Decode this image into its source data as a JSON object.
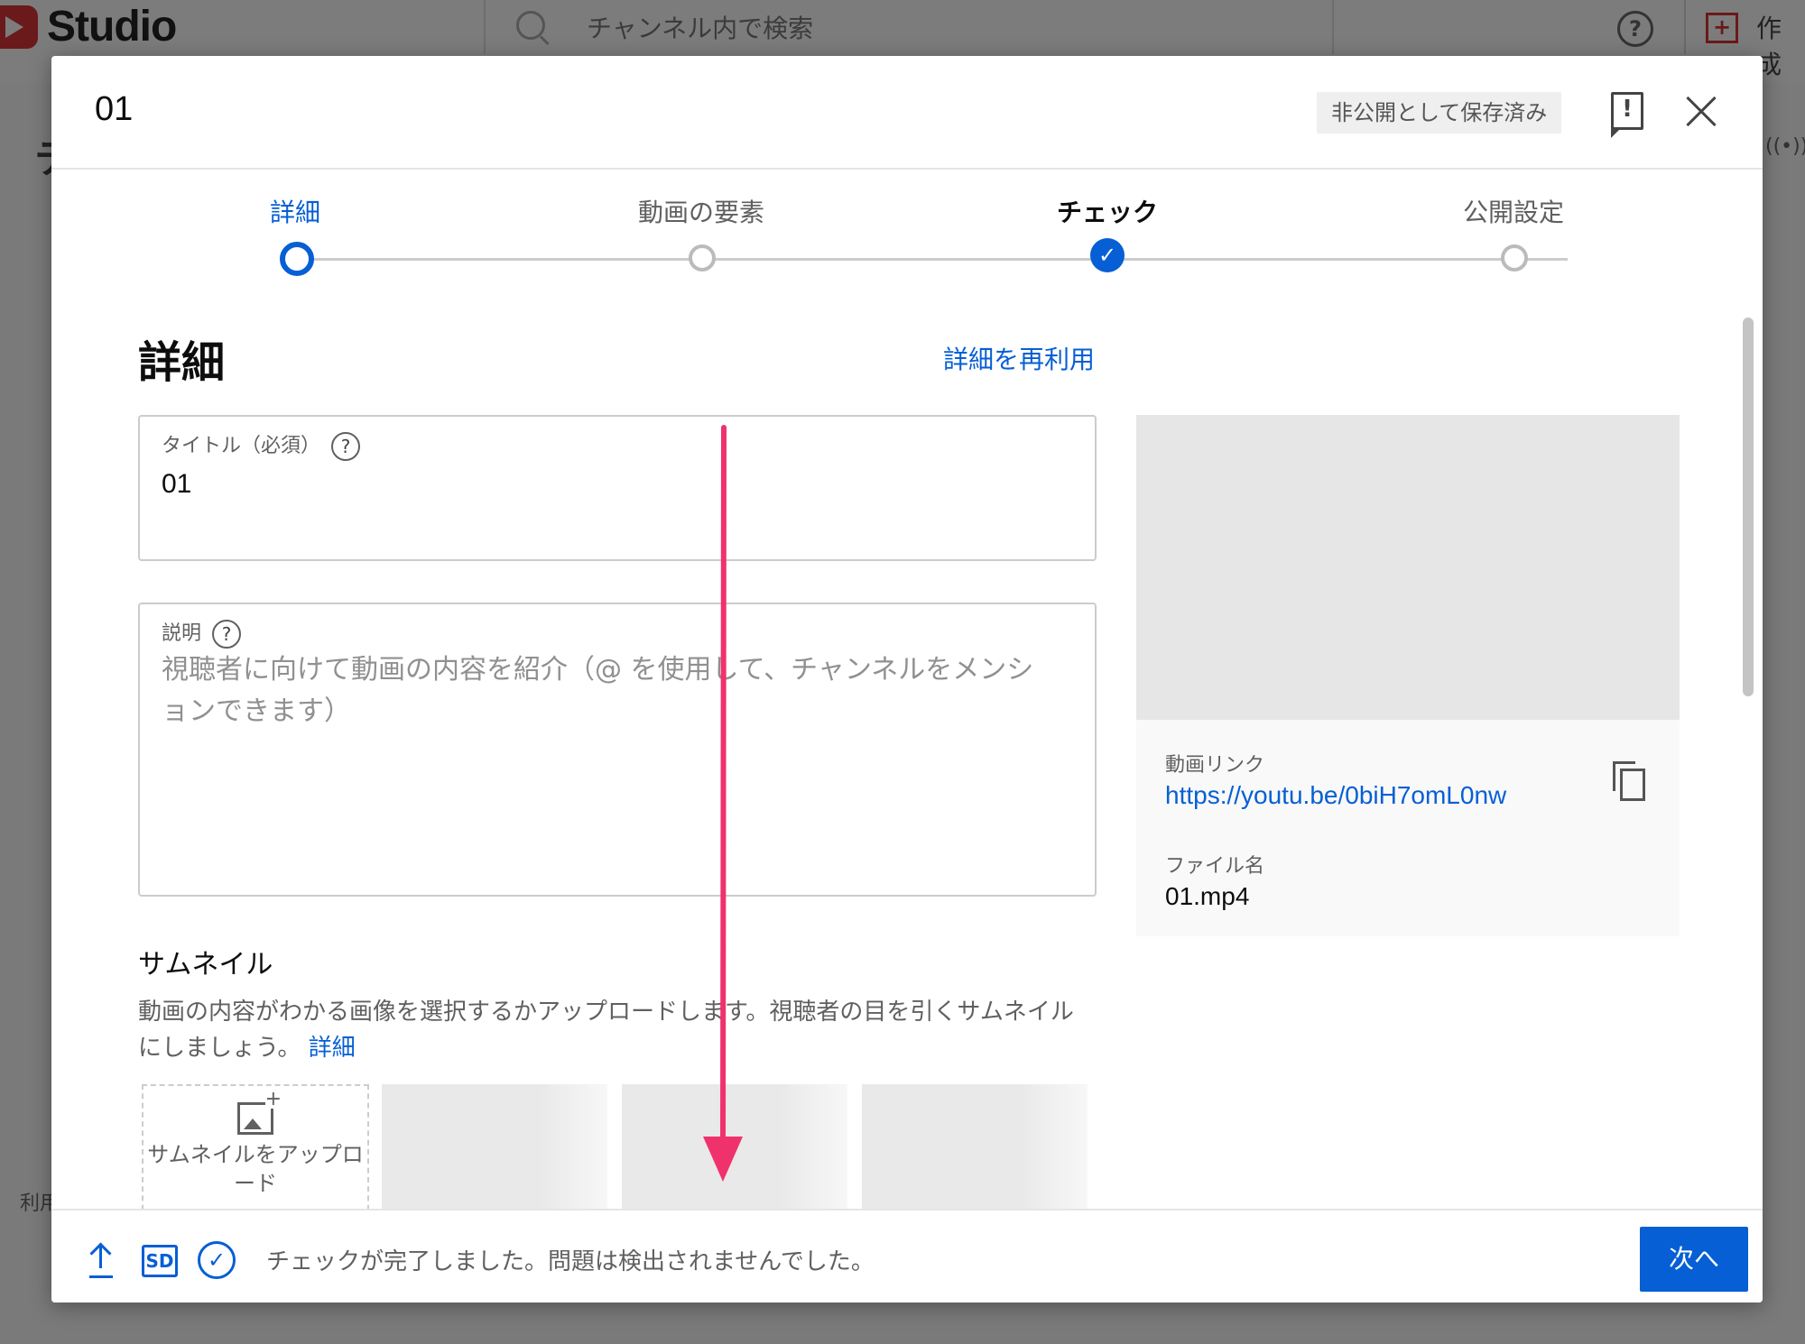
{
  "app": {
    "logo_text": "Studio",
    "search_placeholder": "チャンネル内で検索",
    "help_glyph": "?",
    "create_label": "作成",
    "side_fragment_1": "テ",
    "side_fragment_2": "利用",
    "live_glyph": "((•))"
  },
  "dialog": {
    "title": "01",
    "saved_status": "非公開として保存済み",
    "feedback_icon": "feedback-icon",
    "close_icon": "close-icon"
  },
  "stepper": {
    "steps": [
      {
        "label": "詳細",
        "state": "active"
      },
      {
        "label": "動画の要素",
        "state": "pending"
      },
      {
        "label": "チェック",
        "state": "done",
        "glyph": "✓"
      },
      {
        "label": "公開設定",
        "state": "pending"
      }
    ]
  },
  "details": {
    "heading": "詳細",
    "reuse_link": "詳細を再利用",
    "title_field": {
      "label": "タイトル（必須）",
      "help": "?",
      "value": "01"
    },
    "description_field": {
      "label": "説明",
      "help": "?",
      "placeholder": "視聴者に向けて動画の内容を紹介（@ を使用して、チャンネルをメンションできます）"
    },
    "thumbnail": {
      "heading": "サムネイル",
      "description": "動画の内容がわかる画像を選択するかアップロードします。視聴者の目を引くサムネイルにしましょう。",
      "learn_more": "詳細",
      "upload_label": "サムネイルをアップロード"
    }
  },
  "video_info": {
    "link_label": "動画リンク",
    "link_url": "https://youtu.be/0biH7omL0nw",
    "filename_label": "ファイル名",
    "filename": "01.mp4"
  },
  "footer": {
    "sd_badge": "SD",
    "check_glyph": "✓",
    "status": "チェックが完了しました。問題は検出されませんでした。",
    "next_button": "次へ"
  },
  "colors": {
    "accent": "#065fd4",
    "annotation_arrow": "#f0326c"
  }
}
